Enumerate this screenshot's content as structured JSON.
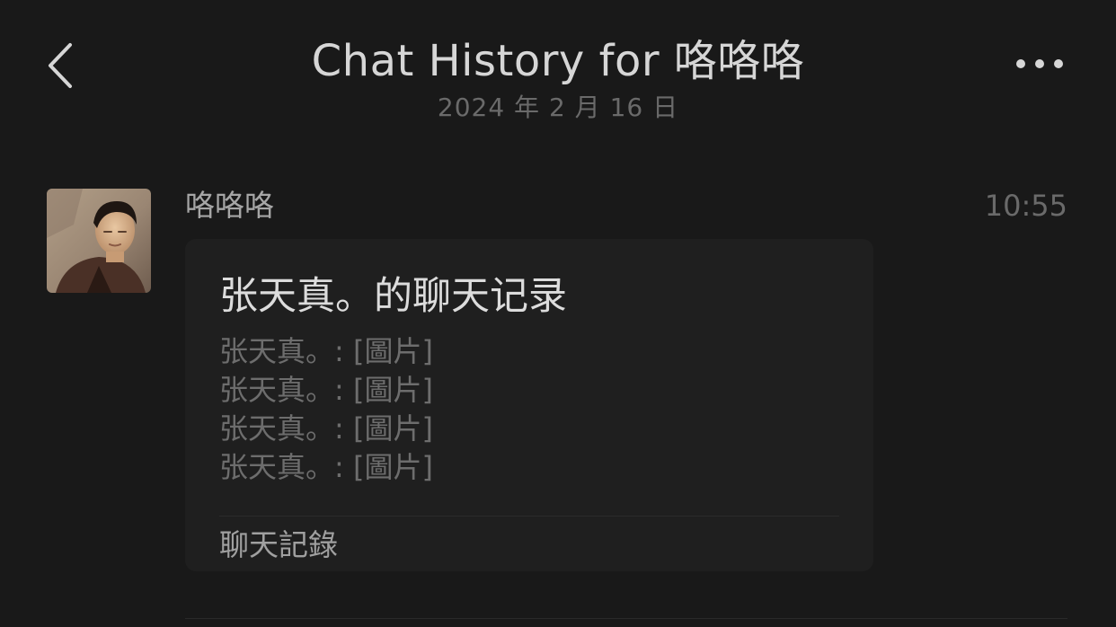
{
  "header": {
    "title": "Chat History for 咯咯咯",
    "date": "2024 年 2 月 16 日",
    "back_icon": "chevron-left-icon",
    "more_icon": "more-horizontal-icon"
  },
  "message": {
    "sender": "咯咯咯",
    "time": "10:55",
    "card": {
      "title": "张天真。的聊天记录",
      "lines": [
        "张天真。: [圖片]",
        "张天真。: [圖片]",
        "张天真。: [圖片]",
        "张天真。: [圖片]"
      ],
      "footer": "聊天記錄"
    }
  },
  "colors": {
    "background": "#191919",
    "card": "#1f1f1f",
    "primary_text": "#d6d6d6",
    "secondary_text": "#6a6a6a"
  }
}
